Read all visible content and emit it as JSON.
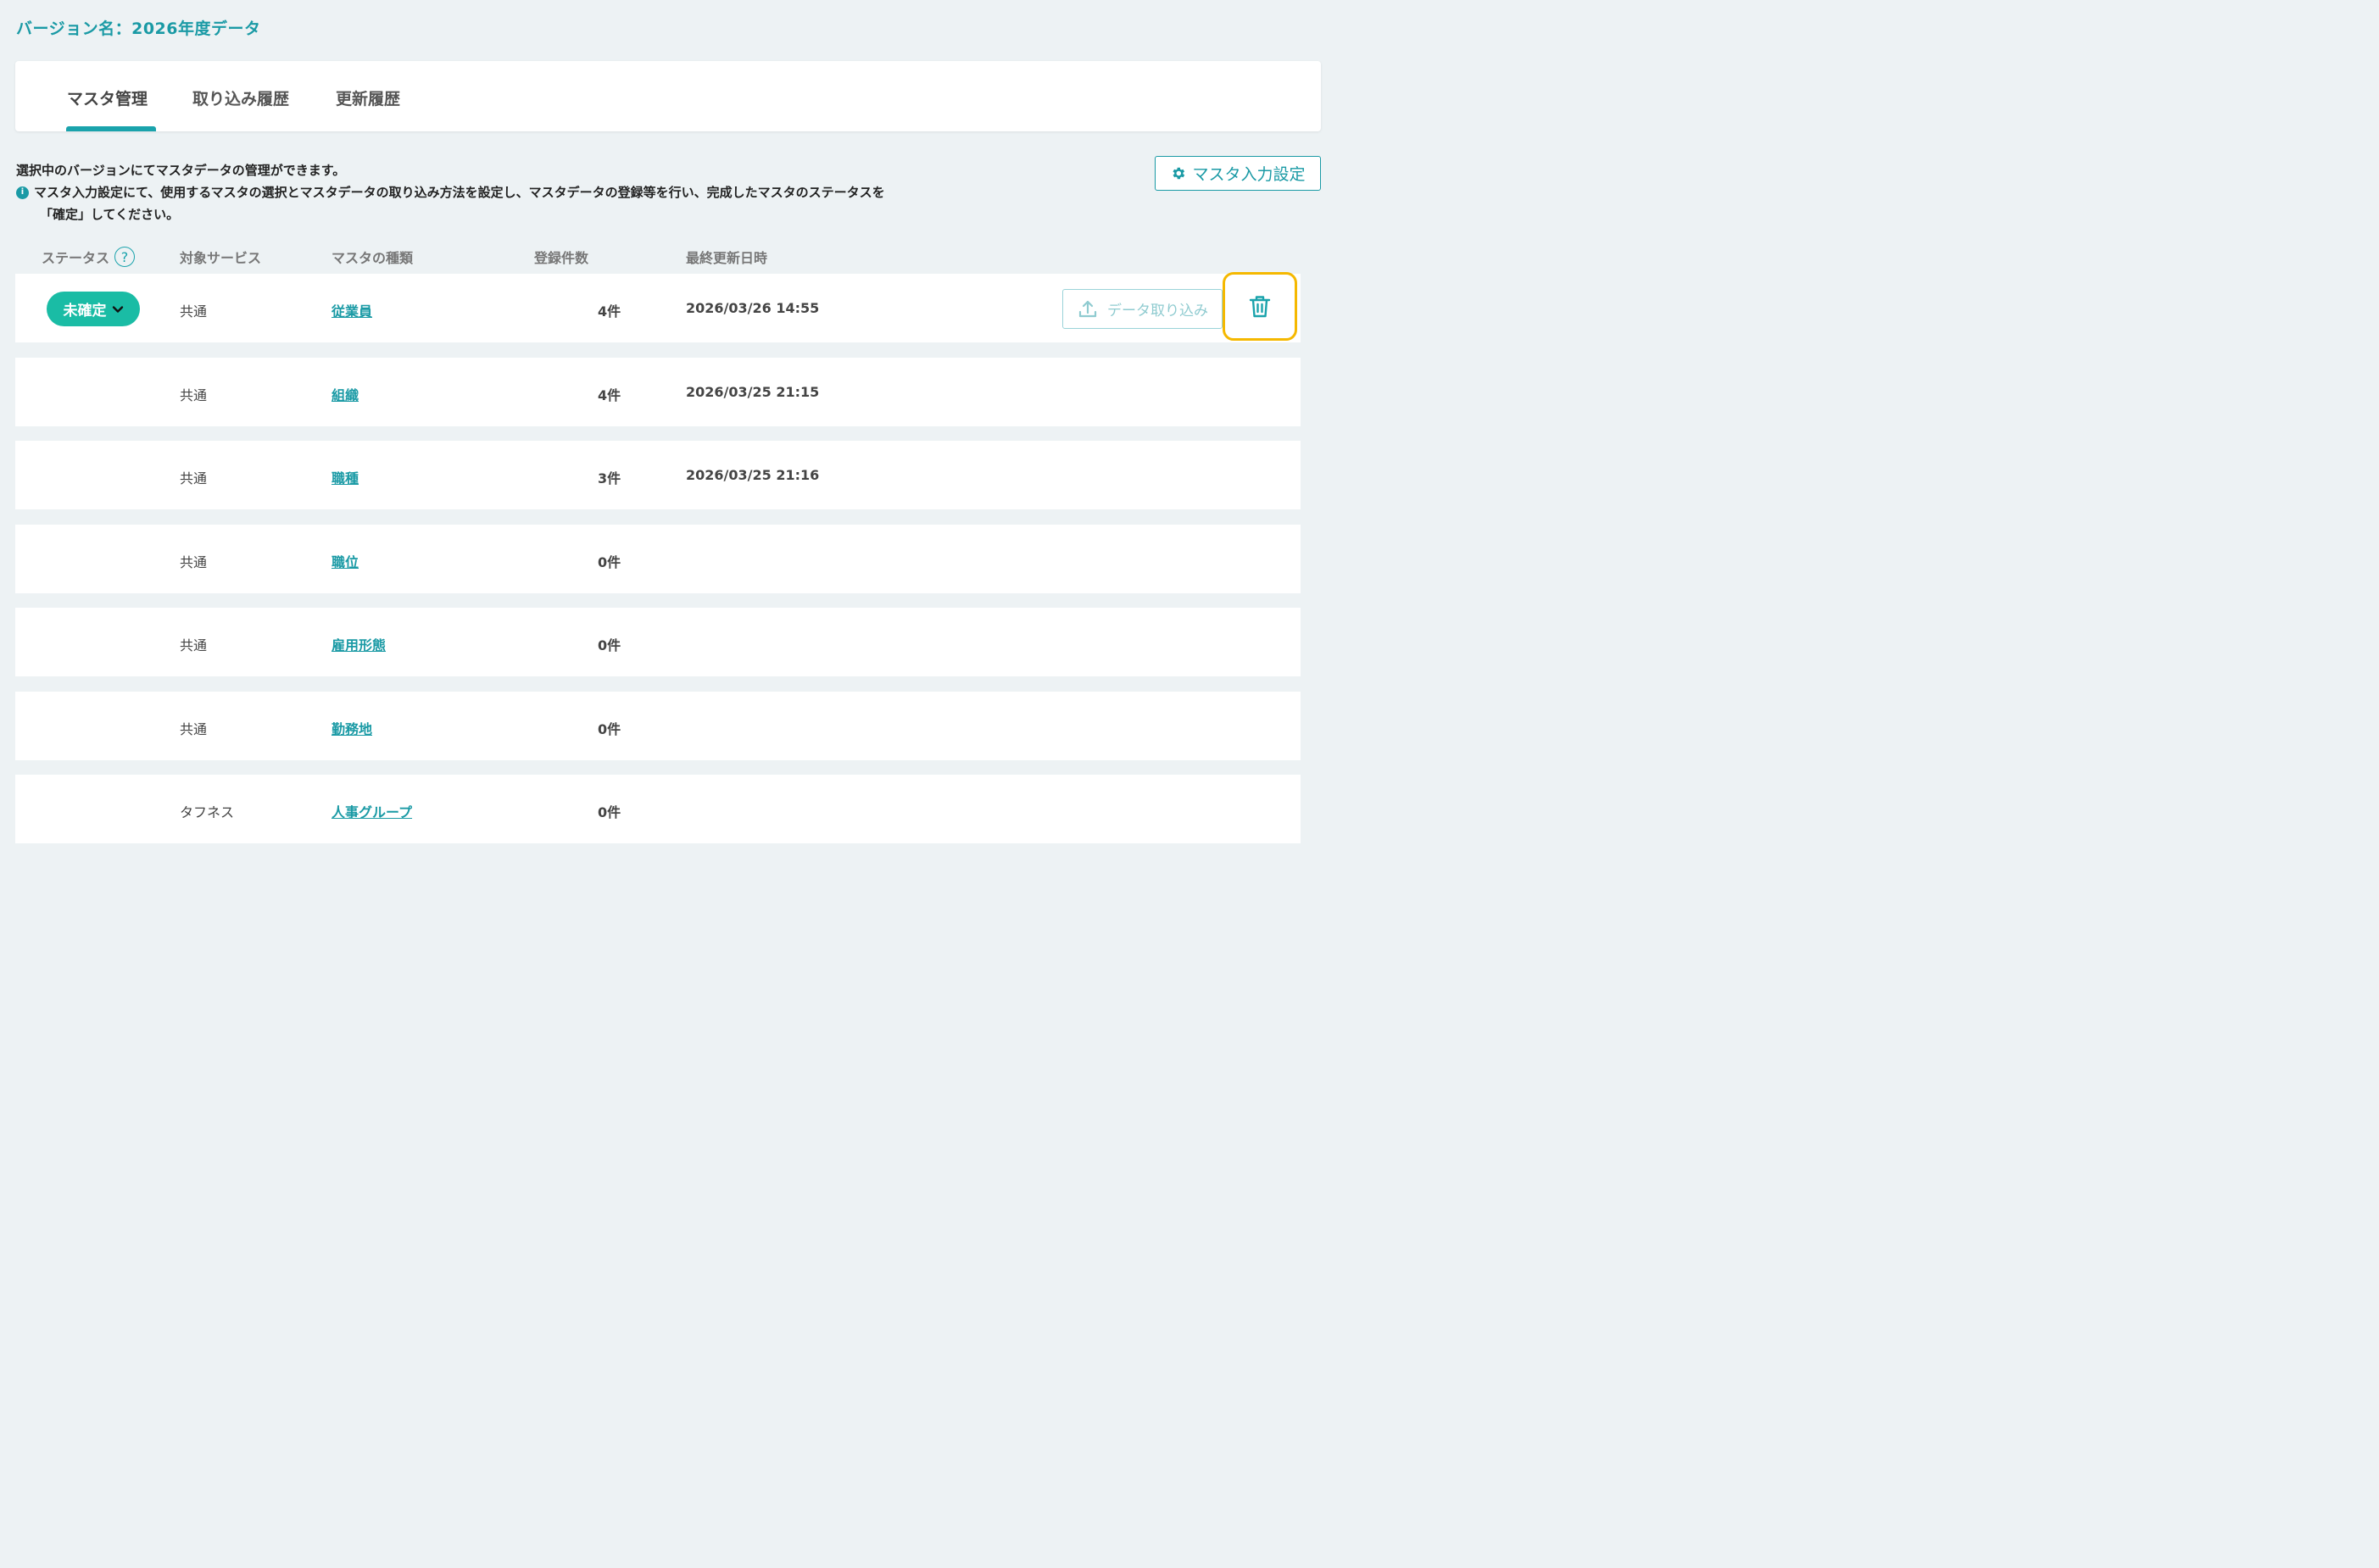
{
  "version": {
    "title": "バージョン名：2026年度データ"
  },
  "tabs": [
    {
      "label": "マスタ管理",
      "active": true
    },
    {
      "label": "取り込み履歴",
      "active": false
    },
    {
      "label": "更新履歴",
      "active": false
    }
  ],
  "description": {
    "line1": "選択中のバージョンにてマスタデータの管理ができます。",
    "line2": "マスタ入力設定にて、使用するマスタの選択とマスタデータの取り込み方法を設定し、マスタデータの登録等を行い、完成したマスタのステータスを",
    "line3": "「確定」してください。",
    "info_icon": "i"
  },
  "settings_button": {
    "label": "マスタ入力設定",
    "icon": "gear-icon"
  },
  "columns": {
    "status": "ステータス",
    "service": "対象サービス",
    "master": "マスタの種類",
    "count": "登録件数",
    "updated": "最終更新日時",
    "help_icon": "?"
  },
  "rows": [
    {
      "status": "未確定",
      "service": "共通",
      "master": "従業員",
      "count": "4件",
      "updated": "2026/03/26 14:55",
      "import_label": "データ取り込み"
    },
    {
      "service": "共通",
      "master": "組織",
      "count": "4件",
      "updated": "2026/03/25 21:15"
    },
    {
      "service": "共通",
      "master": "職種",
      "count": "3件",
      "updated": "2026/03/25 21:16"
    },
    {
      "service": "共通",
      "master": "職位",
      "count": "0件",
      "updated": ""
    },
    {
      "service": "共通",
      "master": "雇用形態",
      "count": "0件",
      "updated": ""
    },
    {
      "service": "共通",
      "master": "勤務地",
      "count": "0件",
      "updated": ""
    },
    {
      "service": "タフネス",
      "master": "人事グループ",
      "count": "0件",
      "updated": ""
    }
  ],
  "colors": {
    "accent": "#1a9aa5",
    "status_badge": "#1abca5",
    "highlight": "#f5b800",
    "background": "#edf2f4"
  }
}
